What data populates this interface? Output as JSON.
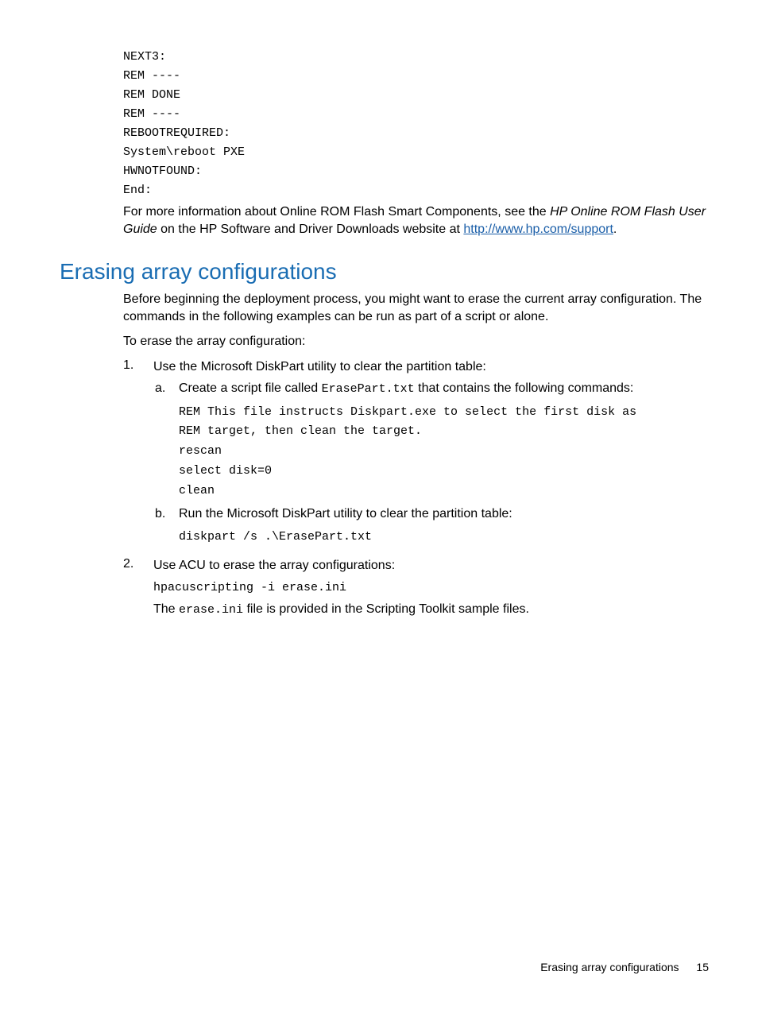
{
  "code_block_top": "NEXT3:\nREM ----\nREM DONE\nREM ----\nREBOOTREQUIRED:\nSystem\\reboot PXE\nHWNOTFOUND:\nEnd:",
  "para1_a": "For more information about Online ROM Flash Smart Components, see the ",
  "para1_i": "HP Online ROM Flash User Guide",
  "para1_b": " on the HP Software and Driver Downloads website at ",
  "para1_link": "http://www.hp.com/support",
  "para1_c": ".",
  "section_heading": "Erasing array configurations",
  "para2": "Before beginning the deployment process, you might want to erase the current array configuration. The commands in the following examples can be run as part of a script or alone.",
  "para3": "To erase the array configuration:",
  "ol": {
    "item1_marker": "1.",
    "item1_text": "Use the Microsoft DiskPart utility to clear the partition table:",
    "item1_a_marker": "a.",
    "item1_a_text_a": "Create a script file called ",
    "item1_a_code": "ErasePart.txt",
    "item1_a_text_b": " that contains the following commands:",
    "item1_a_codeblock": "REM This file instructs Diskpart.exe to select the first disk as\nREM target, then clean the target.\nrescan\nselect disk=0\nclean",
    "item1_b_marker": "b.",
    "item1_b_text": "Run the Microsoft DiskPart utility to clear the partition table:",
    "item1_b_codeblock": "diskpart /s .\\ErasePart.txt",
    "item2_marker": "2.",
    "item2_text": "Use ACU to erase the array configurations:",
    "item2_codeblock": "hpacuscripting -i erase.ini",
    "item2_after_a": "The ",
    "item2_after_code": "erase.ini",
    "item2_after_b": " file is provided in the Scripting Toolkit sample files."
  },
  "footer_text": "Erasing array configurations",
  "footer_page": "15"
}
